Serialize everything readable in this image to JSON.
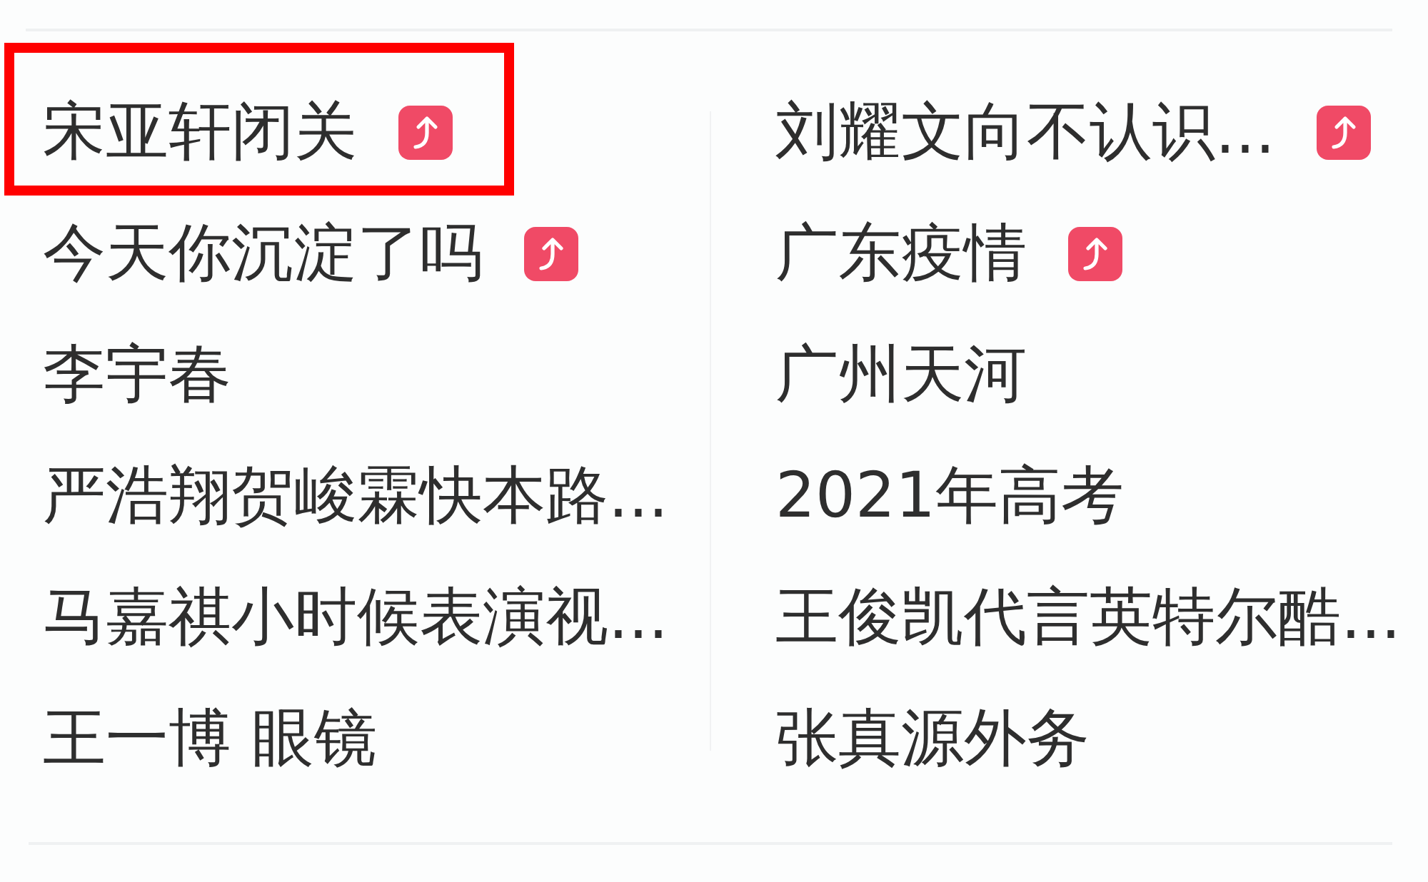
{
  "hot_searches": {
    "columns": [
      {
        "items": [
          {
            "text": "宋亚轩闭关",
            "rising": true,
            "highlighted": true
          },
          {
            "text": "今天你沉淀了吗",
            "rising": true,
            "highlighted": false
          },
          {
            "text": "李宇春",
            "rising": false,
            "highlighted": false
          },
          {
            "text": "严浩翔贺峻霖快本路...",
            "rising": false,
            "highlighted": false
          },
          {
            "text": "马嘉祺小时候表演视...",
            "rising": false,
            "highlighted": false
          },
          {
            "text": "王一博 眼镜",
            "rising": false,
            "highlighted": false
          }
        ]
      },
      {
        "items": [
          {
            "text": "刘耀文向不认识...",
            "rising": true,
            "highlighted": false
          },
          {
            "text": "广东疫情",
            "rising": true,
            "highlighted": false
          },
          {
            "text": "广州天河",
            "rising": false,
            "highlighted": false
          },
          {
            "text": "2021年高考",
            "rising": false,
            "highlighted": false
          },
          {
            "text": "王俊凯代言英特尔酷...",
            "rising": false,
            "highlighted": false
          },
          {
            "text": "张真源外务",
            "rising": false,
            "highlighted": false
          }
        ]
      }
    ]
  }
}
